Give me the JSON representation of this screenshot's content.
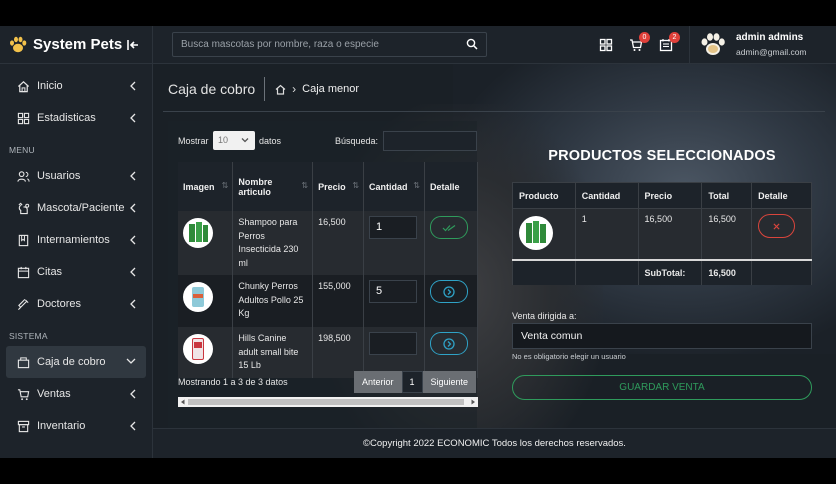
{
  "brand": {
    "name": "System Pets"
  },
  "search": {
    "placeholder": "Busca mascotas por nombre, raza o especie"
  },
  "top_icons": {
    "cart_badge": "0",
    "orders_badge": "2"
  },
  "user": {
    "name": "admin admins",
    "email": "admin@gmail.com"
  },
  "sidebar": {
    "items_top": [
      {
        "label": "Inicio"
      },
      {
        "label": "Estadisticas"
      }
    ],
    "menu_title": "MENU",
    "menu_items": [
      {
        "label": "Usuarios"
      },
      {
        "label": "Mascota/Paciente"
      },
      {
        "label": "Internamientos"
      },
      {
        "label": "Citas"
      },
      {
        "label": "Doctores"
      }
    ],
    "system_title": "SISTEMA",
    "system_items": [
      {
        "label": "Caja de cobro"
      },
      {
        "label": "Ventas"
      },
      {
        "label": "Inventario"
      }
    ]
  },
  "page": {
    "title": "Caja de cobro",
    "breadcrumb_current": "Caja menor"
  },
  "table": {
    "show_label": "Mostrar",
    "page_size": "10",
    "data_label": "datos",
    "search_label": "Búsqueda:",
    "columns": [
      "Imagen",
      "Nombre articulo",
      "Precio",
      "Cantidad",
      "Detalle"
    ],
    "rows": [
      {
        "name": "Shampoo para Perros Insecticida 230 ml",
        "price": "16,500",
        "qty": "1"
      },
      {
        "name": "Chunky Perros Adultos Pollo 25 Kg",
        "price": "155,000",
        "qty": "5"
      },
      {
        "name": "Hills Canine adult small bite 15 Lb",
        "price": "198,500",
        "qty": ""
      }
    ],
    "info": "Mostrando 1 a 3 de 3 datos",
    "prev": "Anterior",
    "page": "1",
    "next": "Siguiente"
  },
  "selected": {
    "title": "PRODUCTOS SELECCIONADOS",
    "columns": [
      "Producto",
      "Cantidad",
      "Precio",
      "Total",
      "Detalle"
    ],
    "rows": [
      {
        "qty": "1",
        "price": "16,500",
        "total": "16,500"
      }
    ],
    "subtotal_label": "SubTotal:",
    "subtotal_value": "16,500"
  },
  "sale": {
    "label": "Venta dirigida a:",
    "value": "Venta comun",
    "help": "No es obligatorio elegir un usuario",
    "save": "GUARDAR VENTA"
  },
  "footer": {
    "text": "©Copyright 2022 ECONOMIC Todos los derechos reservados."
  },
  "colors": {
    "success": "#2f9b5c",
    "info": "#2fa2c6",
    "danger": "#d9453c",
    "sidebar": "#1d232a"
  }
}
